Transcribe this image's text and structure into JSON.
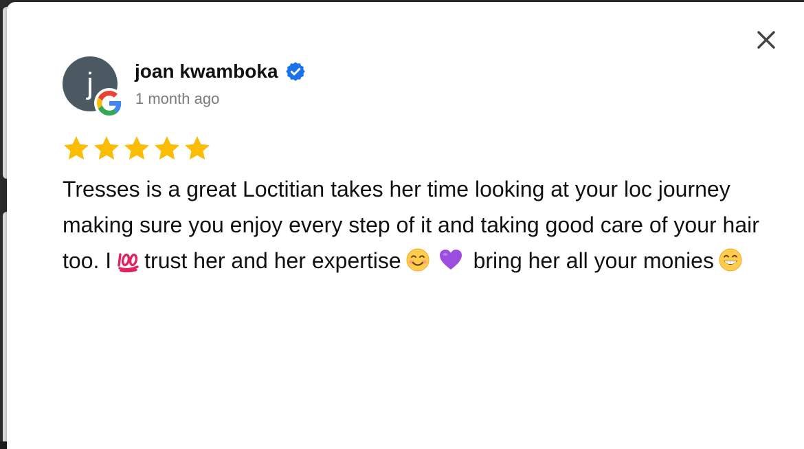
{
  "modal": {
    "close_icon": "close-icon"
  },
  "reviewer": {
    "avatar_initial": "j",
    "avatar_color": "#4b5963",
    "name": "joan kwamboka",
    "verified_icon": "verified-badge-icon",
    "source_icon": "google-icon",
    "timestamp": "1 month ago"
  },
  "rating": {
    "stars": 5,
    "max": 5,
    "star_color": "#fbbc04"
  },
  "review": {
    "segment_1": "Tresses is a great Loctitian takes her time looking at your loc journey making sure you enjoy every step of it and taking good care of your hair too. I",
    "emoji_1": "hundred-points-emoji",
    "segment_2": "trust her and her expertise",
    "emoji_2": "smiling-face-emoji",
    "emoji_3": "purple-heart-emoji",
    "segment_3": "bring her all your monies",
    "emoji_4": "grinning-face-emoji"
  }
}
